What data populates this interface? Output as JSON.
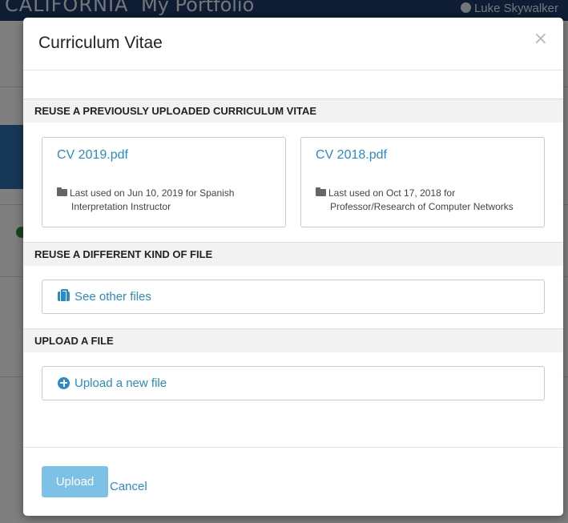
{
  "background": {
    "brand_text": "CALIFORNIA",
    "app_title": "My Portfolio",
    "user_name": "Luke Skywalker"
  },
  "modal": {
    "title": "Curriculum Vitae",
    "close_glyph": "×"
  },
  "sections": {
    "reuse_cv": "REUSE A PREVIOUSLY UPLOADED CURRICULUM VITAE",
    "reuse_other": "REUSE A DIFFERENT KIND OF FILE",
    "upload": "UPLOAD A FILE"
  },
  "cv_files": [
    {
      "name": "CV 2019.pdf",
      "meta_line1": "Last used on Jun 10, 2019 for Spanish",
      "meta_line2": "Interpretation Instructor"
    },
    {
      "name": "CV 2018.pdf",
      "meta_line1": "Last used on Oct 17, 2018 for",
      "meta_line2": "Professor/Research of Computer Networks"
    }
  ],
  "actions": {
    "see_other_files": "See other files",
    "upload_new_file": "Upload a new file"
  },
  "footer": {
    "upload_label": "Upload",
    "cancel_label": "Cancel"
  },
  "icons": {
    "folder": "folder-icon",
    "briefcase": "briefcase-icon",
    "plus": "plus-circle-icon",
    "close": "close-icon",
    "user": "user-icon"
  },
  "colors": {
    "accent": "#2a8bc8",
    "upload_button": "#7ec1e6",
    "topbar": "#1d3b66",
    "section_bg": "#f2f2f2"
  }
}
